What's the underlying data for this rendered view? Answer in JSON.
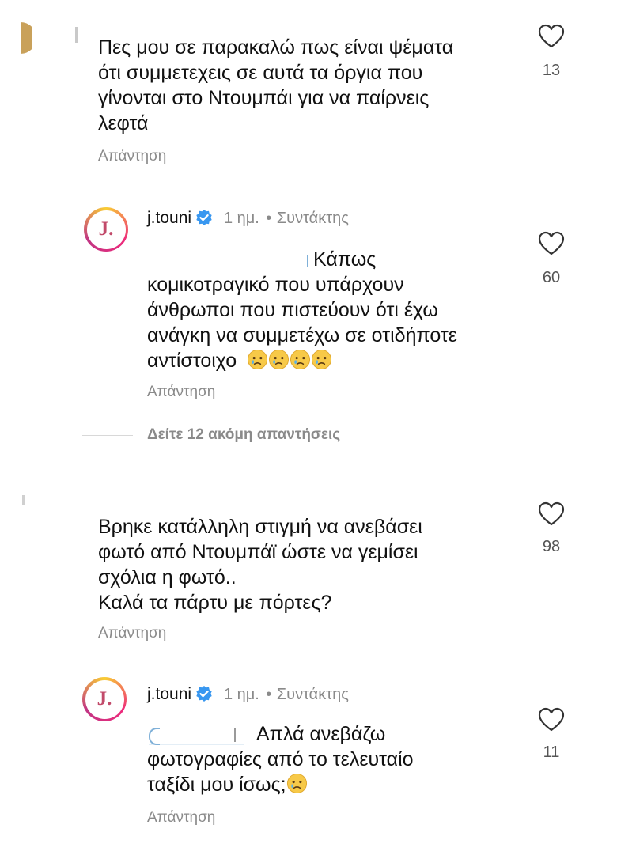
{
  "comments": [
    {
      "text_lines": [
        "Πες μου σε παρακαλώ πως είναι ψέματα",
        "ότι συμμετεχεις σε αυτά τα όργια που",
        "γίνονται στο Ντουμπάι για να παίρνεις",
        "λεφτά"
      ],
      "reply_label": "Απάντηση",
      "likes": "13"
    },
    {
      "username": "j.touni",
      "avatar_letter": "J.",
      "time": "1 ημ.",
      "separator": "•",
      "role": "Συντάκτης",
      "text_lines": [
        "Κάπως",
        "κομικοτραγικό που υπάρχουν",
        "άνθρωποι που πιστεύουν ότι έχω",
        "ανάγκη να συμμετέχω σε οτιδήποτε",
        "αντίστοιχο"
      ],
      "reply_label": "Απάντηση",
      "likes": "60"
    },
    {
      "view_more": "Δείτε 12 ακόμη απαντήσεις"
    },
    {
      "text_lines": [
        "Βρηκε κατάλληλη στιγμή να ανεβάσει",
        "φωτό από Ντουμπάϊ ώστε να γεμίσει",
        "σχόλια η φωτό..",
        "Καλά τα πάρτυ με πόρτες?"
      ],
      "reply_label": "Απάντηση",
      "likes": "98"
    },
    {
      "username": "j.touni",
      "avatar_letter": "J.",
      "time": "1 ημ.",
      "separator": "•",
      "role": "Συντάκτης",
      "text_lines": [
        "Απλά ανεβάζω",
        "φωτογραφίες από το τελευταίο",
        "ταξίδι μου ίσως;"
      ],
      "reply_label": "Απάντηση",
      "likes": "11"
    }
  ],
  "icons": {
    "like": "heart-outline-icon",
    "verified": "verified-badge-icon",
    "emoji": "sad-crying-face-emoji"
  },
  "colors": {
    "verified_blue": "#3897f0",
    "muted": "#8a8a8a",
    "text": "#111111"
  }
}
